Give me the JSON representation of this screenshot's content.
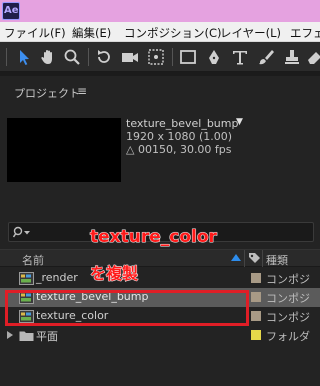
{
  "app": {
    "logo_text": "Ae",
    "titlebar_color": "#e5a2e0"
  },
  "menubar": {
    "items": [
      {
        "label": "ファイル(F)"
      },
      {
        "label": "編集(E)"
      },
      {
        "label": "コンポジション(C)"
      },
      {
        "label": "レイヤー(L)"
      },
      {
        "label": "エフェク"
      }
    ]
  },
  "toolbar": {
    "tools": [
      "selection-tool-icon",
      "hand-tool-icon",
      "zoom-tool-icon",
      "rotate-tool-icon",
      "camera-tool-icon",
      "pan-behind-tool-icon",
      "rectangle-tool-icon",
      "pen-tool-icon",
      "type-tool-icon",
      "brush-tool-icon",
      "clone-stamp-tool-icon",
      "eraser-tool-icon"
    ],
    "active_tool": "selection-tool-icon"
  },
  "project_panel": {
    "title": "プロジェクト",
    "menu_glyph": "≡",
    "selected_item": {
      "name": "texture_bevel_bump",
      "dropdown_glyph": "▼",
      "resolution": "1920 x 1080 (1.00)",
      "duration": "△ 00150, 30.00 fps"
    },
    "search_value": "",
    "columns": {
      "name": "名前",
      "type": "種類"
    },
    "items": [
      {
        "name": "_render",
        "type": "コンポジ",
        "swatch_color": "#a89a86",
        "kind": "composition",
        "selected": false
      },
      {
        "name": "texture_bevel_bump",
        "type": "コンポジ",
        "swatch_color": "#a89a86",
        "kind": "composition",
        "selected": true
      },
      {
        "name": "texture_color",
        "type": "コンポジ",
        "swatch_color": "#a89a86",
        "kind": "composition",
        "selected": false
      },
      {
        "name": "平面",
        "type": "フォルダ",
        "swatch_color": "#e6d84a",
        "kind": "folder",
        "selected": false
      }
    ]
  },
  "annotations": {
    "label_1": "texture_color",
    "label_2": "を複製",
    "color": "#ff1a1a"
  }
}
